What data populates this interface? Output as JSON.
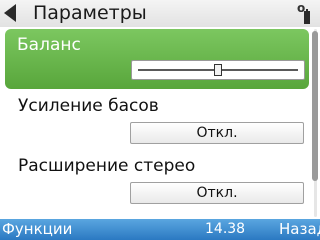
{
  "header": {
    "title": "Параметры",
    "back_icon": "back-arrow-icon",
    "status_icons": [
      "indicator-icon",
      "battery-icon"
    ]
  },
  "settings": [
    {
      "label": "Баланс",
      "control": "slider",
      "level": 0.5,
      "selected": true
    },
    {
      "label": "Усиление басов",
      "control": "value",
      "value": "Откл."
    },
    {
      "label": "Расширение стерео",
      "control": "value",
      "value": "Откл."
    }
  ],
  "softkeys": {
    "left": "Функции",
    "clock": "14.38",
    "right": "Назад"
  },
  "colors": {
    "selection": "#5aad3e",
    "softkey_bar": "#3a8dd2",
    "header": "#ececec"
  }
}
